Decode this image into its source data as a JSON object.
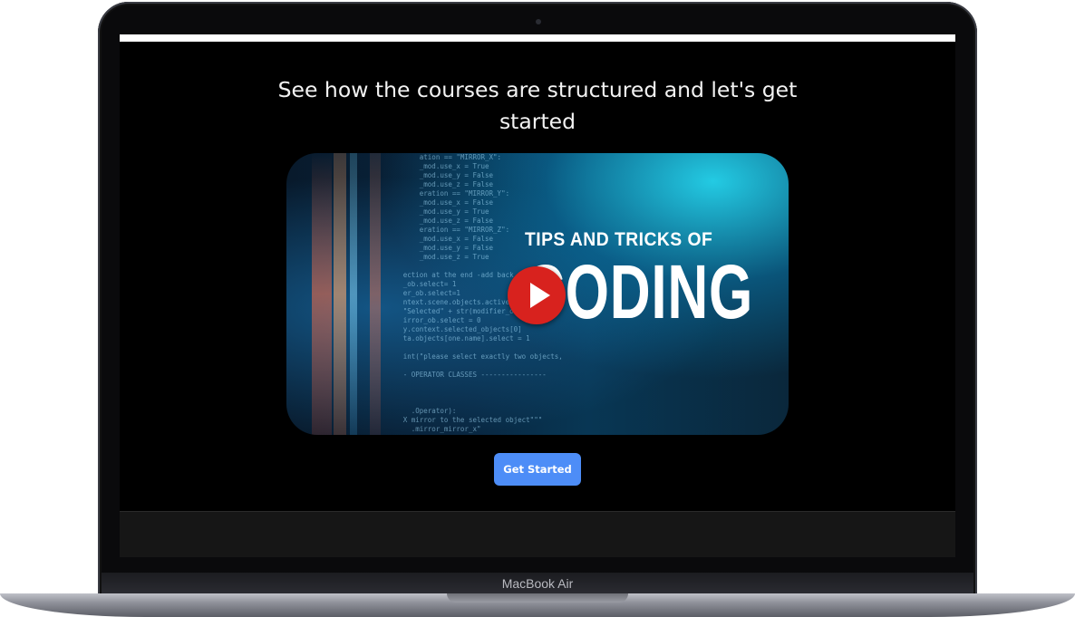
{
  "device": {
    "brand_label": "MacBook Air"
  },
  "page": {
    "heading": "See how the courses are structured and let's get started",
    "cta_label": "Get Started",
    "cta_color": "#4d8df7"
  },
  "video": {
    "title_line1": "TIPS AND TRICKS OF",
    "title_line2": "CODING",
    "play_button_icon": "play-icon",
    "play_button_color": "#d8221e",
    "code_text": "                 ation == \"MIRROR_X\":\n                 _mod.use_x = True\n                 _mod.use_y = False\n                 _mod.use_z = False\n                 eration == \"MIRROR_Y\":\n                 _mod.use_x = False\n                 _mod.use_y = True\n                 _mod.use_z = False\n                 eration == \"MIRROR_Z\":\n                 _mod.use_x = False\n                 _mod.use_y = False\n                 _mod.use_z = True\n\n             ection at the end -add back the dese\n             _ob.select= 1\n             er_ob.select=1\n             ntext.scene.objects.active = modifie\n             \"Selected\" + str(modifier_ob)) # mod\n             irror_ob.select = 0\n             y.context.selected_objects[0]\n             ta.objects[one.name].select = 1\n\n             int(\"please select exactly two objects,\n\n             - OPERATOR CLASSES ----------------\n\n\n\n               .Operator):\n             X mirror to the selected object\"\"\"\n               .mirror_mirror_x\"\n             or X\""
  }
}
